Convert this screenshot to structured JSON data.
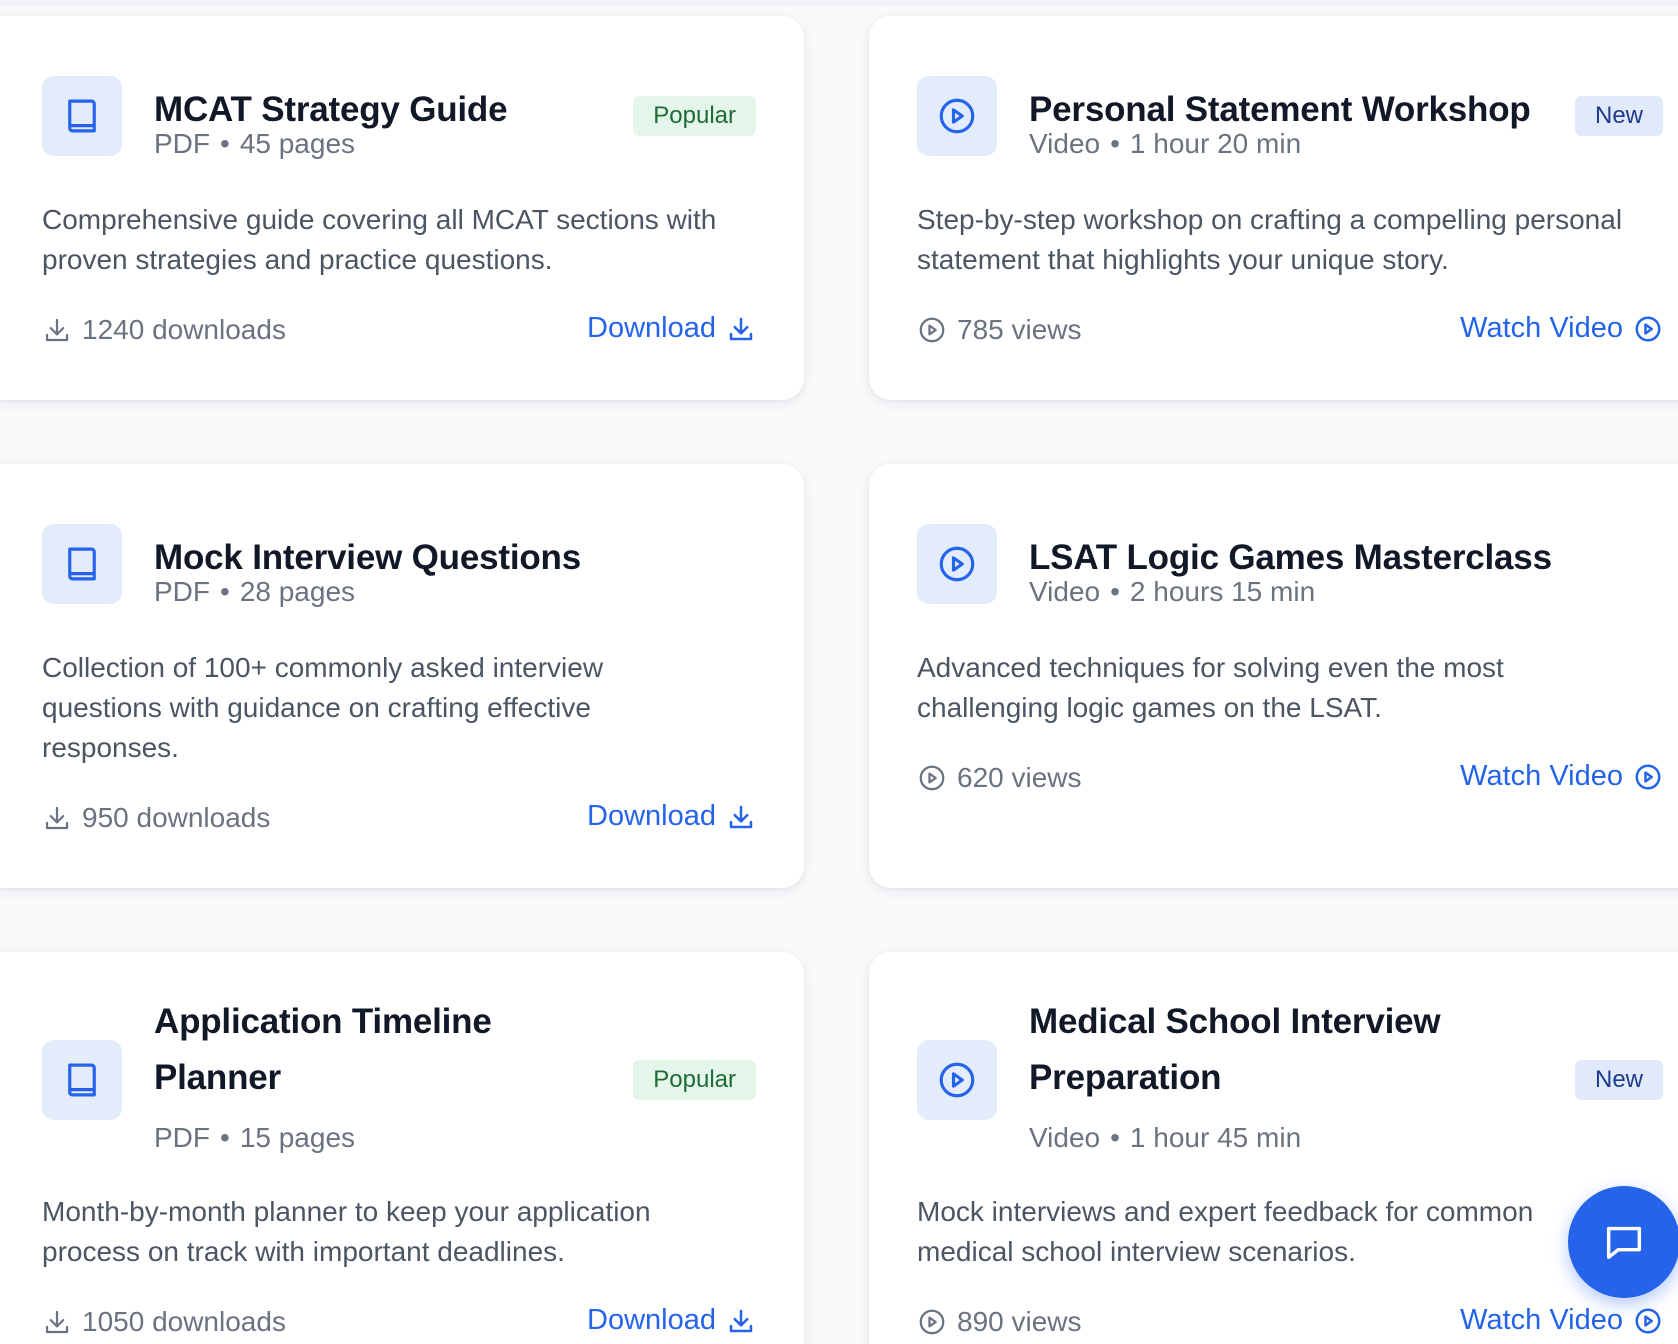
{
  "resources": [
    {
      "title": "MCAT Strategy Guide",
      "type": "PDF",
      "detail": "45 pages",
      "badge": "Popular",
      "description": "Comprehensive guide covering all MCAT sections with proven strategies and practice questions.",
      "stat": "1240 downloads",
      "action": "Download",
      "icon": "book-icon"
    },
    {
      "title": "Personal Statement Workshop",
      "type": "Video",
      "detail": "1 hour 20 min",
      "badge": "New",
      "description": "Step-by-step workshop on crafting a compelling personal statement that highlights your unique story.",
      "stat": "785 views",
      "action": "Watch Video",
      "icon": "play-circle-icon"
    },
    {
      "title": "Mock Interview Questions",
      "type": "PDF",
      "detail": "28 pages",
      "description": "Collection of 100+ commonly asked interview questions with guidance on crafting effective responses.",
      "stat": "950 downloads",
      "action": "Download",
      "icon": "book-icon"
    },
    {
      "title": "LSAT Logic Games Masterclass",
      "type": "Video",
      "detail": "2 hours 15 min",
      "description": "Advanced techniques for solving even the most challenging logic games on the LSAT.",
      "stat": "620 views",
      "action": "Watch Video",
      "icon": "play-circle-icon"
    },
    {
      "title": "Application Timeline Planner",
      "type": "PDF",
      "detail": "15 pages",
      "badge": "Popular",
      "description": "Month-by-month planner to keep your application process on track with important deadlines.",
      "stat": "1050 downloads",
      "action": "Download",
      "icon": "book-icon"
    },
    {
      "title": "Medical School Interview Preparation",
      "type": "Video",
      "detail": "1 hour 45 min",
      "badge": "New",
      "description": "Mock interviews and expert feedback for common medical school interview scenarios.",
      "stat": "890 views",
      "action": "Watch Video",
      "icon": "play-circle-icon"
    }
  ],
  "chat": {
    "icon": "chat-bubble-icon"
  },
  "colors": {
    "accent": "#2563eb",
    "popular_bg": "#e4f6e9",
    "new_bg": "#e1eafb",
    "icon_bg": "#e3ecfb"
  }
}
